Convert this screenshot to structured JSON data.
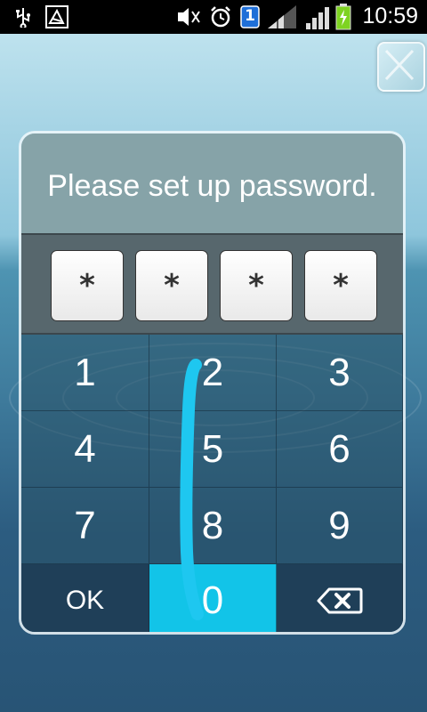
{
  "status_bar": {
    "time": "10:59",
    "sim_badge": "1",
    "icons": [
      "usb-icon",
      "debug-icon",
      "mute-icon",
      "alarm-icon",
      "sim-icon",
      "signal-1-icon",
      "signal-2-icon",
      "battery-charging-icon"
    ]
  },
  "dialog": {
    "prompt": "Please set up password.",
    "digits": [
      "*",
      "*",
      "*",
      "*"
    ]
  },
  "keypad": {
    "keys": [
      "1",
      "2",
      "3",
      "4",
      "5",
      "6",
      "7",
      "8",
      "9"
    ],
    "ok_label": "OK",
    "zero_label": "0",
    "backspace_icon": "backspace-icon"
  },
  "colors": {
    "pressed_key": "#12c4e8",
    "gesture_stroke": "#1ec7f0",
    "prompt_bg": "#86a3a8"
  }
}
